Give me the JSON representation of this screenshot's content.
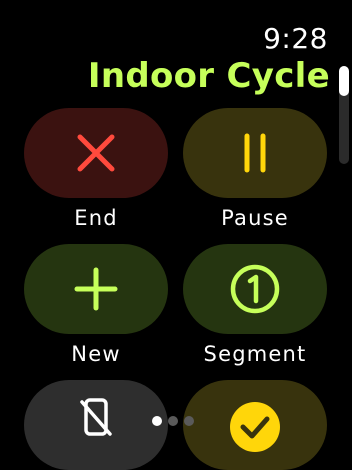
{
  "status": {
    "time": "9:28"
  },
  "workout": {
    "title": "Indoor Cycle"
  },
  "controls": [
    {
      "id": "end",
      "label": "End",
      "icon": "close-icon",
      "color": "#ff4a3d"
    },
    {
      "id": "pause",
      "label": "Pause",
      "icon": "pause-icon",
      "color": "#ffd60a"
    },
    {
      "id": "new",
      "label": "New",
      "icon": "plus-icon",
      "color": "#c6ff5a"
    },
    {
      "id": "segment",
      "label": "Segment",
      "icon": "segment-1-icon",
      "color": "#c6ff5a"
    },
    {
      "id": "water-lock",
      "icon": "water-lock-icon",
      "color": "#ffffff"
    },
    {
      "id": "done",
      "icon": "checkmark-icon",
      "color": "#ffd60a"
    }
  ],
  "pagination": {
    "pages": 3,
    "current": 1
  }
}
